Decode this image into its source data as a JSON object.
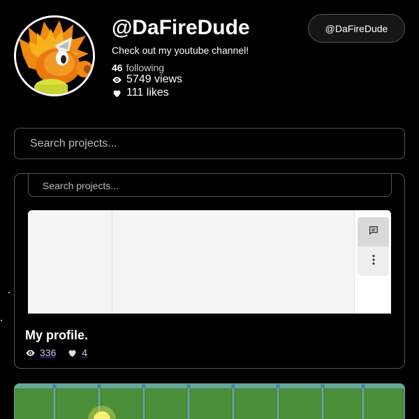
{
  "profile": {
    "username": "@DaFireDude",
    "bio": "Check out my youtube channel!",
    "following_count": "46",
    "following_label": "following",
    "views": "5749 views",
    "likes": "111 likes",
    "handle_button": "@DaFireDude"
  },
  "search": {
    "placeholder": "Search projects..."
  },
  "project": {
    "embed_search_placeholder": "Search projects...",
    "title": "My profile.",
    "views": "336",
    "likes": "4"
  },
  "icons": {
    "avatar": "fire-character-avatar",
    "views": "eye-icon",
    "likes": "heart-icon",
    "comment": "comment-icon",
    "more": "more-vertical-icon"
  },
  "colors": {
    "background": "#000000",
    "border": "#555555",
    "link_underline": "#3b3bd6",
    "thumbnail_green": "#4c8f3a"
  }
}
